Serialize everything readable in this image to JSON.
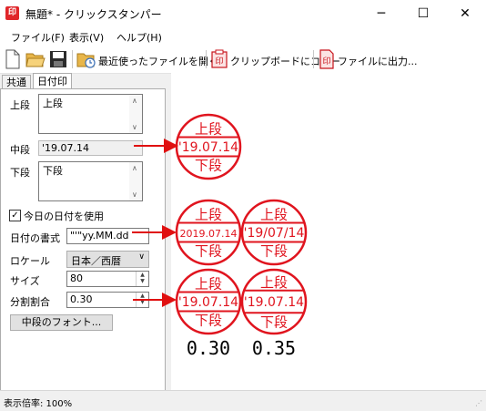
{
  "window": {
    "title": "無題* - クリックスタンパー",
    "app_icon_text": "印",
    "controls": {
      "minimize": "─",
      "maximize": "☐",
      "close": "✕"
    }
  },
  "menu": {
    "file": "ファイル(F)",
    "view": "表示(V)",
    "help": "ヘルプ(H)"
  },
  "toolbar": {
    "recent": "最近使ったファイルを開く...",
    "copy_clipboard": "クリップボードにコピー",
    "output_file": "ファイルに出力..."
  },
  "tabs": {
    "common": "共通",
    "date_stamp": "日付印"
  },
  "form": {
    "top_label": "上段",
    "top_value": "上段",
    "middle_label": "中段",
    "middle_value": "'19.07.14",
    "bottom_label": "下段",
    "bottom_value": "下段",
    "use_today_label": "今日の日付を使用",
    "use_today_checked": true,
    "date_format_label": "日付の書式",
    "date_format_value": "\"'\"yy.MM.dd",
    "locale_label": "ロケール",
    "locale_value": "日本／西暦",
    "size_label": "サイズ",
    "size_value": "80",
    "ratio_label": "分割割合",
    "ratio_value": "0.30",
    "font_button": "中段のフォント..."
  },
  "stamps": [
    {
      "top": "上段",
      "middle": "'19.07.14",
      "bottom": "下段"
    },
    {
      "top": "上段",
      "middle": "2019.07.14",
      "bottom": "下段"
    },
    {
      "top": "上段",
      "middle": "'19/07/14",
      "bottom": "下段"
    },
    {
      "top": "上段",
      "middle": "'19.07.14",
      "bottom": "下段"
    },
    {
      "top": "上段",
      "middle": "'19.07.14",
      "bottom": "下段"
    }
  ],
  "ratio_captions": [
    "0.30",
    "0.35"
  ],
  "colors": {
    "stamp_red": "#e0141e",
    "arrow_red": "#e01010"
  },
  "status": {
    "zoom": "表示倍率: 100%"
  }
}
